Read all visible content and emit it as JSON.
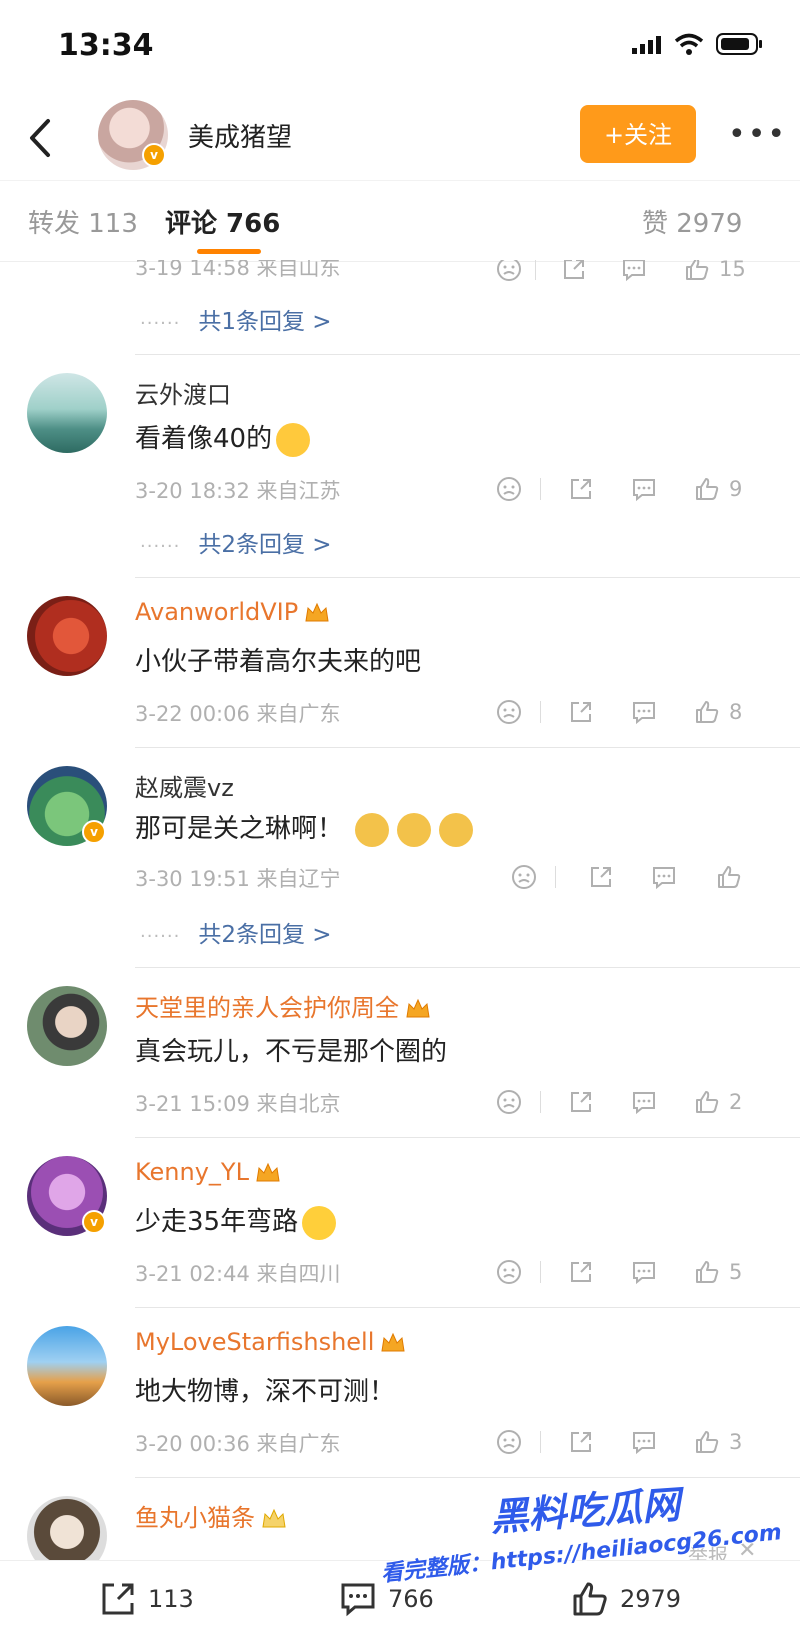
{
  "status_bar": {
    "time": "13:34"
  },
  "header": {
    "username": "美成猪望",
    "follow_label": "+关注",
    "more_label": "•••"
  },
  "tabs": {
    "repost": "转发 113",
    "comments": "评论 766",
    "likes": "赞 2979"
  },
  "prev_comment": {
    "meta": "3-19 14:58 来自山东",
    "likes": "15",
    "replies": "共1条回复 >"
  },
  "comments": [
    {
      "name": "云外渡口",
      "vip": false,
      "text": "看着像40的",
      "meta": "3-20 18:32 来自江苏",
      "likes": "9",
      "replies": "共2条回复 >"
    },
    {
      "name": "AvanworldVIP",
      "vip": true,
      "text": "小伙子带着高尔夫来的吧",
      "meta": "3-22 00:06 来自广东",
      "likes": "8",
      "replies": ""
    },
    {
      "name": "赵威震vz",
      "vip": false,
      "text": "那可是关之琳啊！",
      "meta": "3-30 19:51 来自辽宁",
      "likes": "",
      "replies": "共2条回复 >"
    },
    {
      "name": "天堂里的亲人会护你周全",
      "vip": true,
      "text": "真会玩儿，不亏是那个圈的",
      "meta": "3-21 15:09 来自北京",
      "likes": "2",
      "replies": ""
    },
    {
      "name": "Kenny_YL",
      "vip": true,
      "text": "少走35年弯路",
      "meta": "3-21 02:44 来自四川",
      "likes": "5",
      "replies": ""
    },
    {
      "name": "MyLoveStarfishshell",
      "vip": true,
      "text": "地大物博，深不可测！",
      "meta": "3-20 00:36 来自广东",
      "likes": "3",
      "replies": ""
    },
    {
      "name": "鱼丸小猫条",
      "vip": true,
      "text": "",
      "meta": "",
      "likes": "",
      "replies": ""
    }
  ],
  "overlay": {
    "report": "举报",
    "close": "✕"
  },
  "bottom_bar": {
    "repost": "113",
    "comments": "766",
    "likes": "2979"
  },
  "watermark": {
    "line1": "黑料吃瓜网",
    "line2": "看完整版：https://heiliaocg26.com"
  },
  "colors": {
    "accent": "#ff8200",
    "follow_bg": "#ff9a1a",
    "vip_name": "#e8762d",
    "reply_link": "#4a6fa5",
    "meta": "#b0b0b0",
    "watermark": "#2f5bea"
  },
  "icons": [
    "back-arrow-icon",
    "signal-icon",
    "wifi-icon",
    "battery-icon",
    "verified-badge-icon",
    "dislike-face-icon",
    "share-icon",
    "comment-icon",
    "thumb-up-icon",
    "crown-badge-icon"
  ]
}
